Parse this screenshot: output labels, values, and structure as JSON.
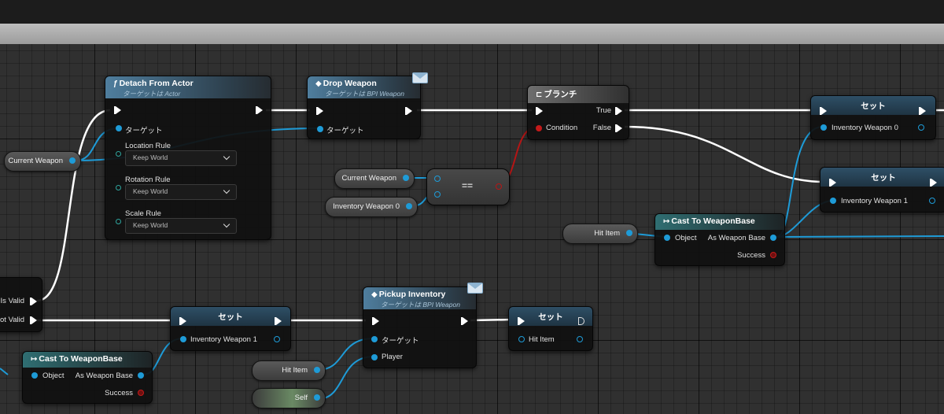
{
  "nodes": {
    "detach": {
      "title": "Detach From Actor",
      "subtitle": "ターゲットは Actor",
      "target": "ターゲット",
      "location_rule": "Location Rule",
      "rotation_rule": "Rotation Rule",
      "scale_rule": "Scale Rule",
      "keep_world": "Keep World"
    },
    "drop": {
      "title": "Drop Weapon",
      "subtitle": "ターゲットは BPI Weapon",
      "target": "ターゲット"
    },
    "branch": {
      "title": "ブランチ",
      "condition": "Condition",
      "true_label": "True",
      "false_label": "False"
    },
    "set_inv0": {
      "title": "セット",
      "pin": "Inventory Weapon 0"
    },
    "set_inv1_top": {
      "title": "セット",
      "pin": "Inventory Weapon 1"
    },
    "cast_top": {
      "title": "Cast To WeaponBase",
      "object": "Object",
      "as_weapon": "As Weapon Base",
      "success": "Success"
    },
    "is_valid": {
      "is_valid": "Is Valid",
      "is_not_valid": "ot Valid"
    },
    "set_inv1_bottom": {
      "title": "セット",
      "pin": "Inventory Weapon 1"
    },
    "pickup": {
      "title": "Pickup Inventory",
      "subtitle": "ターゲットは BPI Weapon",
      "target": "ターゲット",
      "player": "Player"
    },
    "set_hit": {
      "title": "セット",
      "pin": "Hit Item"
    },
    "cast_bottom": {
      "title": "Cast To WeaponBase",
      "object": "Object",
      "as_weapon": "As Weapon Base",
      "success": "Success"
    },
    "equal": {
      "op": "=="
    }
  },
  "variables": {
    "current_weapon_left": "Current Weapon",
    "current_weapon_mid": "Current Weapon",
    "inventory_weapon0": "Inventory Weapon 0",
    "hit_item_right": "Hit Item",
    "hit_item_bottom": "Hit Item",
    "self": "Self"
  },
  "colors": {
    "exec": "#ffffff",
    "object_pin": "#1e9bd7",
    "bool_pin": "#c41a1a"
  }
}
